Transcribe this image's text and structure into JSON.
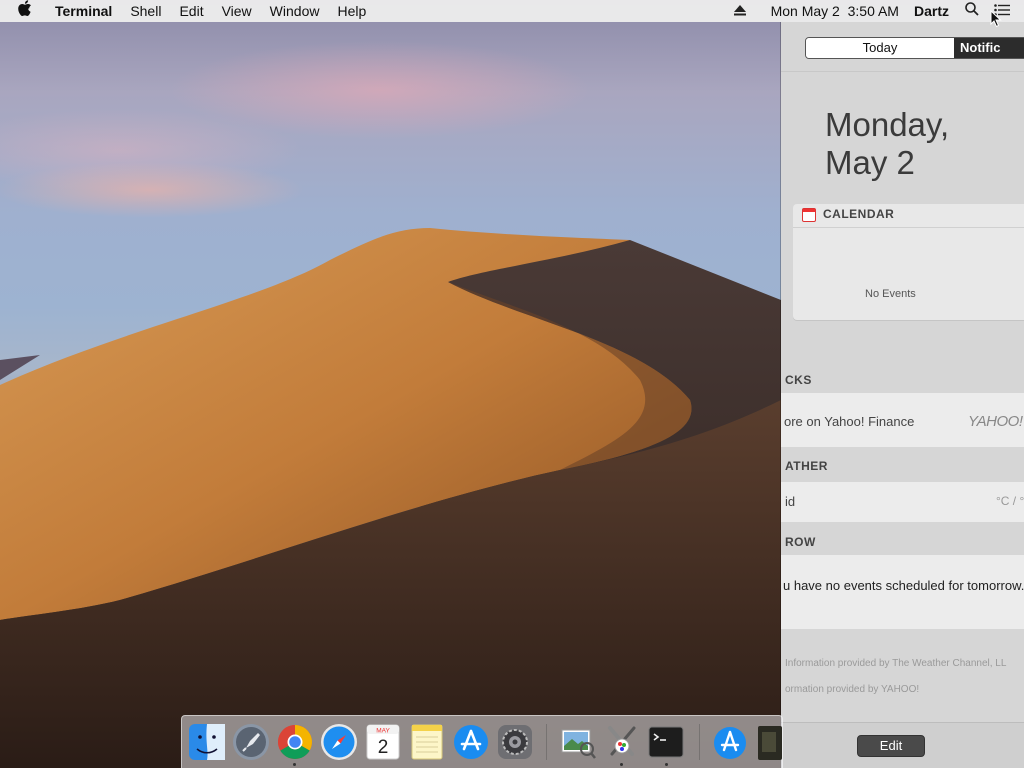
{
  "menubar": {
    "apple_icon": "apple-logo-icon",
    "app_name": "Terminal",
    "menus": [
      "Shell",
      "Edit",
      "View",
      "Window",
      "Help"
    ],
    "eject_icon": "eject-icon",
    "datetime": "Mon May 2  3:50 AM",
    "user": "Dartz",
    "search_icon": "spotlight-search-icon",
    "nc_icon": "notification-center-icon"
  },
  "notification_center": {
    "tabs": {
      "today": "Today",
      "notifications": "Notific"
    },
    "date_line1": "Monday,",
    "date_line2": "May 2",
    "calendar": {
      "title": "CALENDAR",
      "body": "No Events"
    },
    "stocks": {
      "title": "CKS",
      "body": "ore on Yahoo! Finance",
      "logo": "YAHOO!"
    },
    "weather": {
      "title": "ATHER",
      "body": "id",
      "units": "°C / °"
    },
    "tomorrow": {
      "title": "ROW",
      "body": "u have no events scheduled for tomorrow."
    },
    "footer_weather": "Information provided by The Weather Channel, LL",
    "footer_yahoo": "ormation provided by YAHOO!",
    "edit_label": "Edit"
  },
  "dock": {
    "apps": [
      {
        "name": "Finder",
        "icon": "finder-icon",
        "running": false
      },
      {
        "name": "Launchpad",
        "icon": "launchpad-icon",
        "running": false
      },
      {
        "name": "Google Chrome",
        "icon": "chrome-icon",
        "running": true
      },
      {
        "name": "Safari",
        "icon": "safari-icon",
        "running": false
      },
      {
        "name": "Calendar",
        "icon": "calendar-icon",
        "running": false,
        "month": "MAY",
        "day": "2"
      },
      {
        "name": "Notes",
        "icon": "notes-icon",
        "running": false
      },
      {
        "name": "App Store",
        "icon": "app-store-icon",
        "running": false
      },
      {
        "name": "System Preferences",
        "icon": "system-preferences-icon",
        "running": false
      },
      {
        "name": "Preview",
        "icon": "preview-icon",
        "running": false
      },
      {
        "name": "Utilities",
        "icon": "utilities-icon",
        "running": true
      },
      {
        "name": "Terminal",
        "icon": "terminal-icon",
        "running": true
      },
      {
        "name": "App Store Downloads",
        "icon": "app-store-downloads-icon",
        "running": false
      },
      {
        "name": "Trash",
        "icon": "trash-icon",
        "running": false
      }
    ]
  },
  "colors": {
    "menubar_bg": "#ececec",
    "nc_bg": "#d6d6d6",
    "segment_selected": "#ffffff",
    "segment_unselected": "#2c2c2c"
  }
}
